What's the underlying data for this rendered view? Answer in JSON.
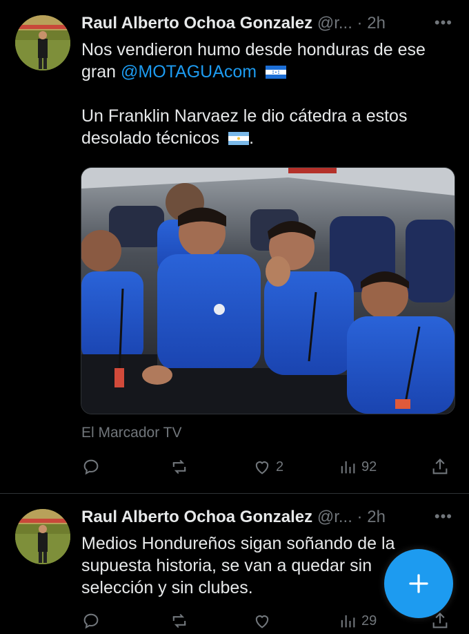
{
  "tweets": [
    {
      "author_name": "Raul Alberto Ochoa Gonzalez",
      "author_handle": "@r...",
      "separator": "·",
      "time": "2h",
      "more_icon": "more-dots-icon",
      "text_line1": "Nos vendieron humo desde honduras de ese",
      "text_line2_pre": "gran ",
      "mention": "@MOTAGUAcom",
      "text_line3": "Un Franklin Narvaez le dio cátedra a estos",
      "text_line4": "desolado técnicos",
      "text_line4_end": ".",
      "media_source": "El Marcador TV",
      "actions": {
        "reply_count": "",
        "retweet_count": "",
        "like_count": "2",
        "views_count": "92"
      }
    },
    {
      "author_name": "Raul Alberto Ochoa Gonzalez",
      "author_handle": "@r...",
      "separator": "·",
      "time": "2h",
      "text_line1": "Medios Hondureños sigan soñando de la",
      "text_line2": "supuesta historia, se van a quedar sin",
      "text_line3": "selección y sin clubes.",
      "actions": {
        "views_count": "29"
      }
    }
  ],
  "colors": {
    "accent": "#1d9bf0",
    "muted": "#71767b",
    "text": "#e7e9ea",
    "background": "#000000"
  },
  "fab_icon": "plus-icon"
}
